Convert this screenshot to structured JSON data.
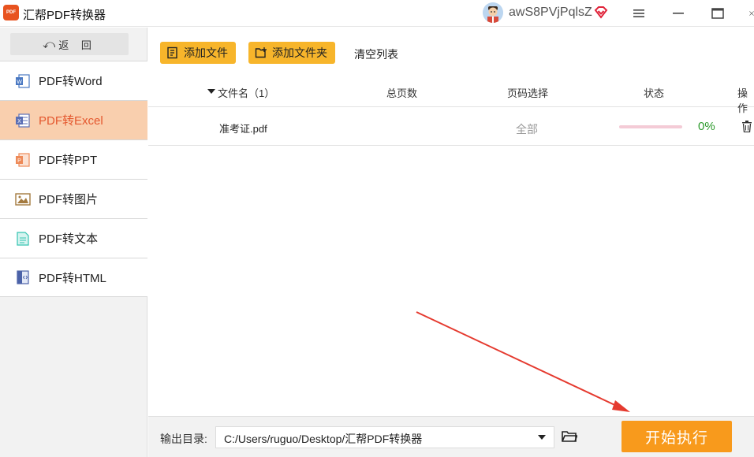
{
  "app": {
    "logo_text": "PDF",
    "title": "汇帮PDF转换器",
    "username": "awS8PVjPqlsZ",
    "window_controls": [
      "menu-icon",
      "minimize-icon",
      "maximize-icon",
      "close-icon"
    ]
  },
  "sidebar": {
    "back_arrow": "⤺",
    "back_label": "返 回",
    "items": [
      {
        "label": "PDF转Word",
        "icon": "word-icon",
        "active": false
      },
      {
        "label": "PDF转Excel",
        "icon": "excel-icon",
        "active": true
      },
      {
        "label": "PDF转PPT",
        "icon": "ppt-icon",
        "active": false
      },
      {
        "label": "PDF转图片",
        "icon": "image-icon",
        "active": false
      },
      {
        "label": "PDF转文本",
        "icon": "text-icon",
        "active": false
      },
      {
        "label": "PDF转HTML",
        "icon": "html-icon",
        "active": false
      }
    ]
  },
  "toolbar": {
    "add_file": "添加文件",
    "add_folder": "添加文件夹",
    "clear_list": "清空列表"
  },
  "table": {
    "headers": {
      "filename": "文件名（1）",
      "pages": "总页数",
      "page_select": "页码选择",
      "status": "状态",
      "action": "操作"
    },
    "rows": [
      {
        "filename": "准考证.pdf",
        "pages": "",
        "page_select": "全部",
        "progress": 0,
        "progress_text": "0%"
      }
    ]
  },
  "bottom": {
    "output_label": "输出目录:",
    "output_path": "C:/Users/ruguo/Desktop/汇帮PDF转换器",
    "start_label": "开始执行"
  },
  "colors": {
    "accent": "#f7b52b",
    "start_button": "#f89a1c",
    "active_nav_bg": "#f9cfae",
    "active_nav_text": "#e4572e",
    "progress_text": "#2c9a2c",
    "annotation_arrow": "#e53a2f"
  }
}
